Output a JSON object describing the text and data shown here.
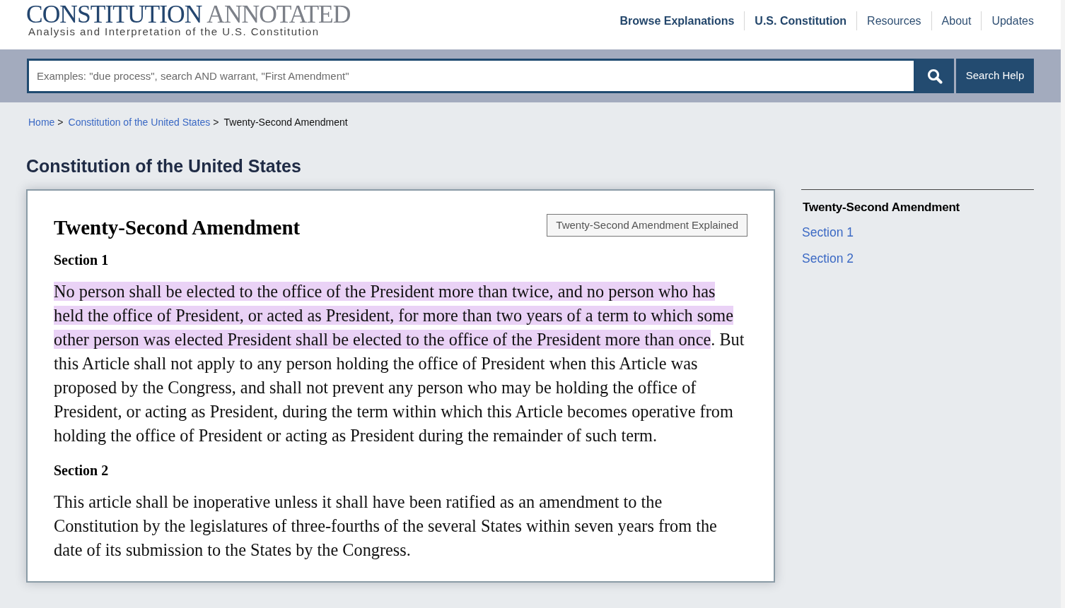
{
  "header": {
    "logo": {
      "primary": "CONSTITUTION",
      "secondary": "ANNOTATED"
    },
    "tagline": "Analysis and Interpretation of the U.S. Constitution",
    "nav": [
      {
        "label": "Browse Explanations",
        "kind": "primary"
      },
      {
        "label": "U.S. Constitution",
        "kind": "primary"
      },
      {
        "label": "Resources",
        "kind": "secondary"
      },
      {
        "label": "About",
        "kind": "secondary"
      },
      {
        "label": "Updates",
        "kind": "secondary"
      }
    ]
  },
  "search": {
    "placeholder": "Examples: \"due process\", search AND warrant, \"First Amendment\"",
    "help_button": "Search Help"
  },
  "breadcrumbs": [
    {
      "label": "Home",
      "kind": "link",
      "separator": ">"
    },
    {
      "label": "Constitution of the United States",
      "kind": "link",
      "separator": ">"
    },
    {
      "label": "Twenty-Second Amendment",
      "kind": "current"
    }
  ],
  "page_title": "Constitution of the United States",
  "article": {
    "title": "Twenty-Second Amendment",
    "explained_button": "Twenty-Second Amendment Explained",
    "sections": [
      {
        "heading": "Section 1",
        "paragraphs": [
          [
            {
              "text": "No person shall be elected to the office of the President more than twice, and no person who has held the office of President, or acted as President, for more than two years of a term to which some other person was elected President shall be elected to the office of the President more than once",
              "highlighted": true
            },
            {
              "text": ". But this Article shall not apply to any person holding the office of President when this Article was proposed by the Congress, and shall not prevent any person who may be holding the office of President, or acting as President, during the term within which this Article becomes operative from holding the office of President or acting as President during the remainder of such term.",
              "highlighted": false
            }
          ]
        ]
      },
      {
        "heading": "Section 2",
        "paragraphs": [
          [
            {
              "text": "This article shall be inoperative unless it shall have been ratified as an amendment to the Constitution by the legislatures of three-fourths of the several States within seven years from the date of its submission to the States by the Congress.",
              "highlighted": false
            }
          ]
        ]
      }
    ]
  },
  "sidebar": {
    "title": "Twenty-Second Amendment",
    "links": [
      "Section 1",
      "Section 2"
    ]
  }
}
